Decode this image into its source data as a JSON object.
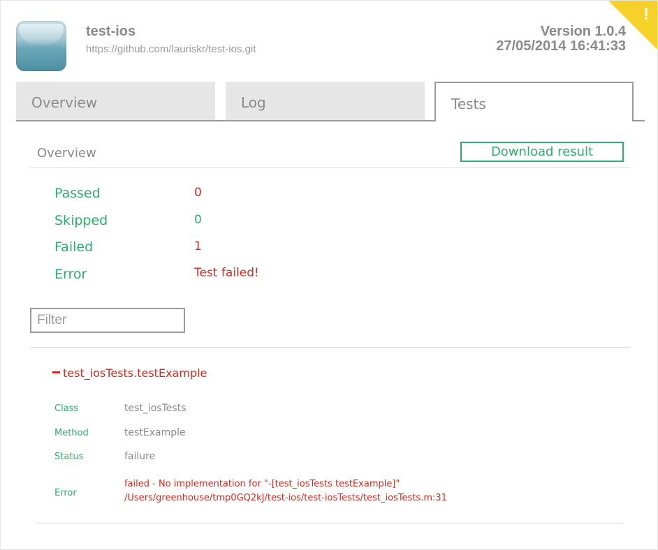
{
  "header": {
    "app_name": "test-ios",
    "repo_url": "https://github.com/lauriskr/test-ios.git",
    "version": "Version 1.0.4",
    "datetime": "27/05/2014 16:41:33",
    "corner_badge": "!"
  },
  "tabs": [
    {
      "label": "Overview",
      "active": false
    },
    {
      "label": "Log",
      "active": false
    },
    {
      "label": "Tests",
      "active": true
    }
  ],
  "overview": {
    "title": "Overview",
    "download_label": "Download result",
    "stats": [
      {
        "label": "Passed",
        "value": "0",
        "status": "red"
      },
      {
        "label": "Skipped",
        "value": "0",
        "status": "green"
      },
      {
        "label": "Failed",
        "value": "1",
        "status": "red"
      },
      {
        "label": "Error",
        "value": "Test failed!",
        "status": "red"
      }
    ]
  },
  "filter": {
    "placeholder": "Filter",
    "value": ""
  },
  "test": {
    "name": "test_iosTests.testExample",
    "expanded": true,
    "details": {
      "class_label": "Class",
      "class_value": "test_iosTests",
      "method_label": "Method",
      "method_value": "testExample",
      "status_label": "Status",
      "status_value": "failure",
      "error_label": "Error",
      "error_line1": "failed - No implementation for \"-[test_iosTests testExample]\"",
      "error_line2": "/Users/greenhouse/tmp0GQ2kJ/test-ios/test-iosTests/test_iosTests.m:31"
    }
  },
  "colors": {
    "accent_green": "#2eae6c",
    "error_red": "#d42b20",
    "warning_yellow": "#f5d12a",
    "tab_inactive_bg": "#e6e6e6"
  }
}
